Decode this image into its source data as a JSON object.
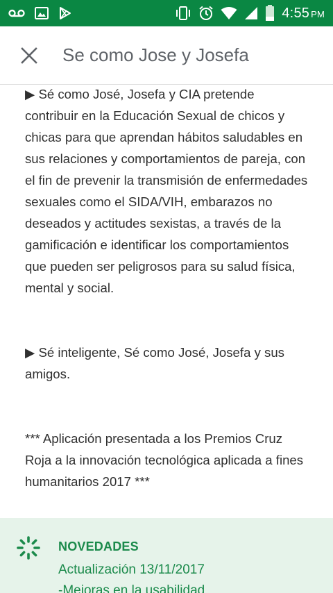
{
  "status_bar": {
    "time": "4:55",
    "ampm": "PM",
    "icons_left": [
      "voicemail-icon",
      "image-icon",
      "play-store-icon"
    ],
    "icons_right": [
      "vibrate-icon",
      "alarm-icon",
      "wifi-icon",
      "signal-icon",
      "battery-icon"
    ],
    "background": "#0a8743"
  },
  "app_bar": {
    "title": "Se como Jose y Josefa",
    "close_icon": "close-icon"
  },
  "description": {
    "paragraphs": [
      "▶ Sé como José, Josefa y CIA pretende contribuir en la Educación Sexual de chicos y chicas para que aprendan hábitos saludables en sus relaciones y comportamientos de pareja, con el fin de prevenir la transmisión de enfermedades sexuales como el SIDA/VIH, embarazos no deseados y actitudes sexistas, a través de la gamificación e identificar los comportamientos que pueden ser peligrosos para su salud física, mental y social.",
      "▶ Sé inteligente, Sé como José, Josefa y sus amigos.",
      "*** Aplicación presentada a los Premios Cruz Roja a la innovación tecnológica aplicada a fines humanitarios 2017  ***"
    ]
  },
  "whats_new": {
    "heading": "NOVEDADES",
    "lines": [
      "Actualización 13/11/2017",
      "-Mejoras en la usabilidad"
    ],
    "icon": "loading-spinner-icon",
    "accent": "#1b8a4b",
    "background": "#e6f3ea"
  }
}
